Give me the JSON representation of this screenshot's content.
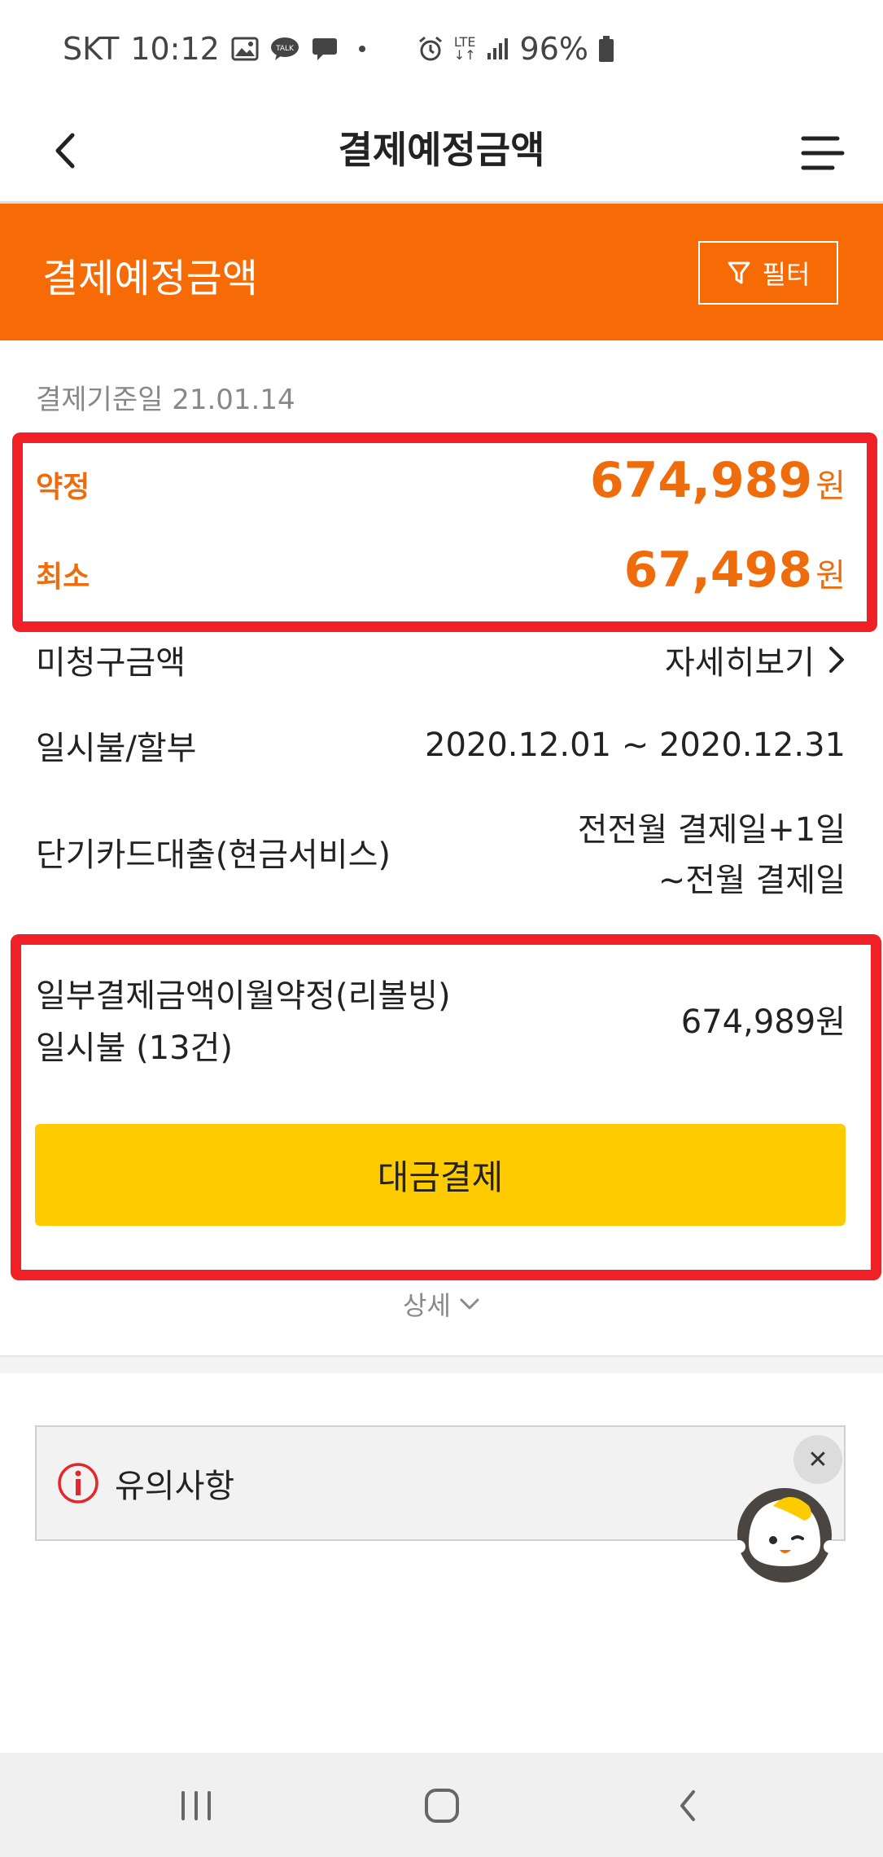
{
  "status_bar": {
    "carrier": "SKT",
    "time": "10:12",
    "network": "LTE",
    "battery": "96%",
    "left_icons": [
      "image-icon",
      "talk-icon",
      "message-icon",
      "dot-icon"
    ],
    "right_icons": [
      "alarm-icon",
      "lte-arrows-icon",
      "signal-icon",
      "battery-icon"
    ]
  },
  "appbar": {
    "title": "결제예정금액"
  },
  "header": {
    "title": "결제예정금액",
    "filter_label": "필터"
  },
  "base_date": "결제기준일 21.01.14",
  "amounts": {
    "promise": {
      "label": "약정",
      "value": "674,989",
      "unit": "원"
    },
    "minimum": {
      "label": "최소",
      "value": "67,498",
      "unit": "원"
    }
  },
  "unbilled": {
    "label": "미청구금액",
    "link": "자세히보기"
  },
  "periods": [
    {
      "label": "일시불/할부",
      "value_lines": [
        "2020.12.01 ~ 2020.12.31"
      ]
    },
    {
      "label": "단기카드대출(현금서비스)",
      "value_lines": [
        "전전월 결제일+1일",
        "~전월 결제일"
      ]
    }
  ],
  "revolving": {
    "label_line1": "일부결제금액이월약정(리볼빙)",
    "label_line2": "일시불 (13건)",
    "amount": "674,989원"
  },
  "pay_button": "대금결제",
  "more_label": "상세",
  "notice": {
    "label": "유의사항"
  },
  "colors": {
    "orange": "#f76b06",
    "amount_orange": "#ee6c0b",
    "highlight_red": "#f02126",
    "button_yellow": "#fdcb00"
  }
}
